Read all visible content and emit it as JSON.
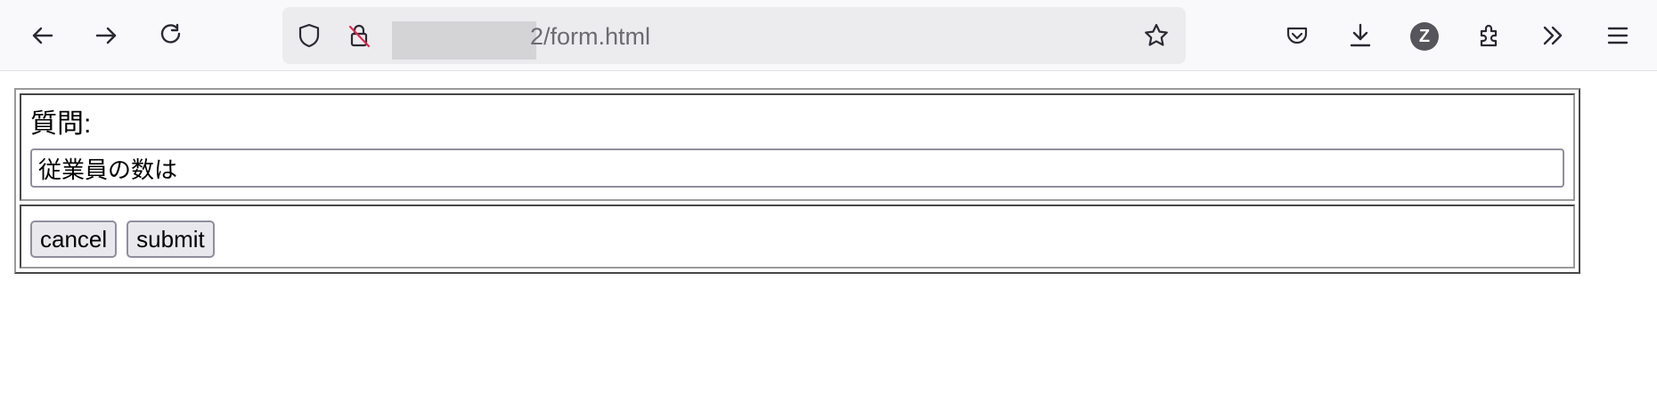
{
  "browser": {
    "url_visible": "2/form.html",
    "avatar_initial": "Z",
    "icons": {
      "back": "arrow-left-icon",
      "forward": "arrow-right-icon",
      "reload": "reload-icon",
      "tracking": "shield-icon",
      "insecure": "lock-crossed-icon",
      "bookmark": "star-icon",
      "pocket": "pocket-icon",
      "downloads": "download-icon",
      "extensions": "puzzle-icon",
      "overflow": "chevrons-right-icon",
      "menu": "hamburger-icon"
    }
  },
  "form": {
    "question_label": "質問:",
    "question_value": "従業員の数は",
    "cancel_label": "cancel",
    "submit_label": "submit"
  }
}
